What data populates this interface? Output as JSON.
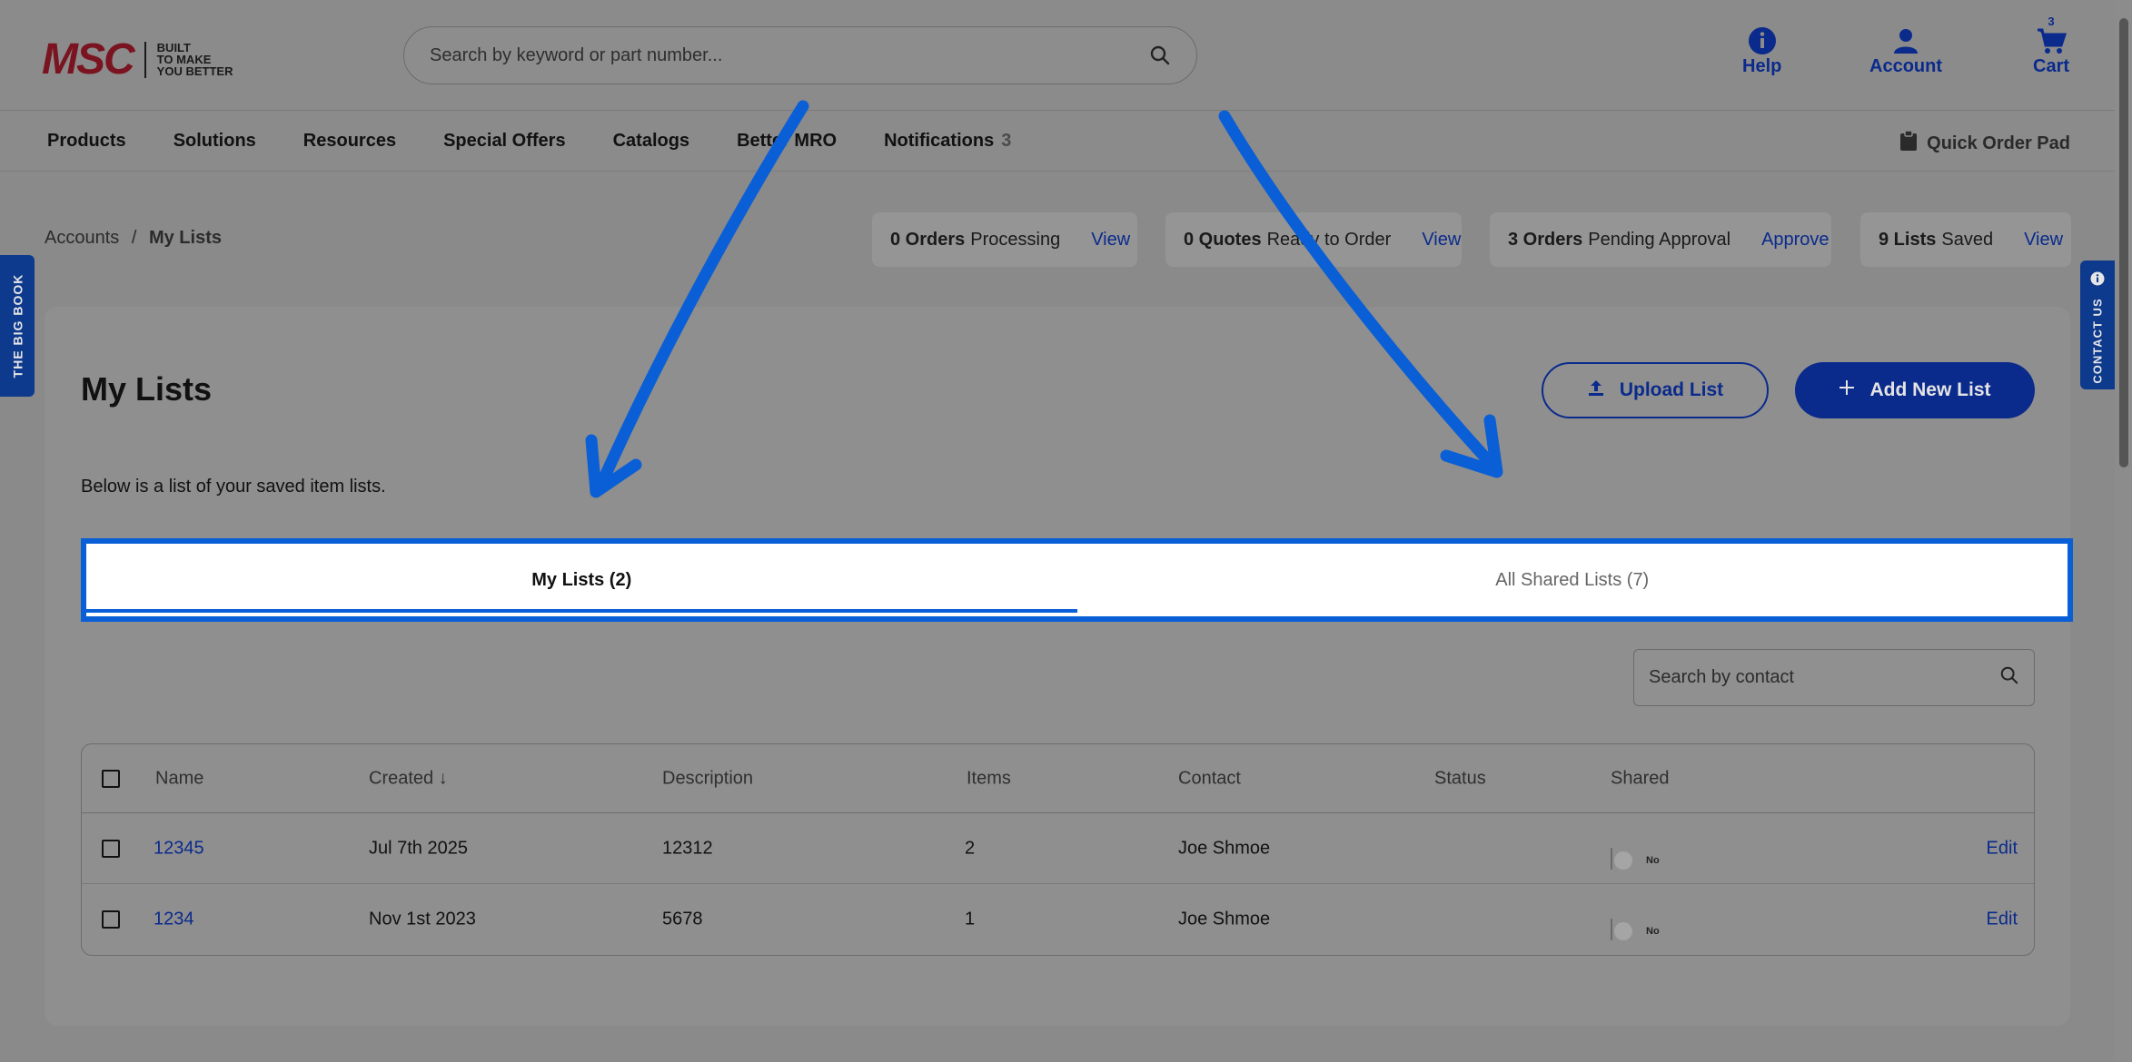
{
  "header": {
    "logo_text": "MSC",
    "logo_tagline": [
      "BUILT",
      "TO MAKE",
      "YOU BETTER"
    ],
    "search_placeholder": "Search by keyword or part number...",
    "help_label": "Help",
    "account_label": "Account",
    "cart_label": "Cart",
    "cart_count": "3"
  },
  "nav": {
    "items": [
      "Products",
      "Solutions",
      "Resources",
      "Special Offers",
      "Catalogs",
      "Better MRO"
    ],
    "notifications_label": "Notifications",
    "notifications_count": "3",
    "quick_order_label": "Quick Order Pad"
  },
  "breadcrumb": {
    "parent": "Accounts",
    "separator": "/",
    "current": "My Lists"
  },
  "status_pills": [
    {
      "count": "0 Orders",
      "text": "Processing",
      "action": "View"
    },
    {
      "count": "0 Quotes",
      "text": "Ready to Order",
      "action": "View"
    },
    {
      "count": "3 Orders",
      "text": "Pending Approval",
      "action": "Approve"
    },
    {
      "count": "9 Lists",
      "text": "Saved",
      "action": "View"
    }
  ],
  "side": {
    "left_label": "THE BIG BOOK",
    "right_label": "CONTACT US"
  },
  "main": {
    "title": "My Lists",
    "upload_label": "Upload List",
    "add_label": "Add New List",
    "description": "Below is a list of your saved item lists.",
    "tabs": [
      {
        "label": "My Lists (2)",
        "active": true
      },
      {
        "label": "All Shared Lists (7)",
        "active": false
      }
    ],
    "contact_search_placeholder": "Search by contact"
  },
  "table": {
    "columns": [
      "Name",
      "Created ↓",
      "Description",
      "Items",
      "Contact",
      "Status",
      "Shared"
    ],
    "rows": [
      {
        "name": "12345",
        "created": "Jul 7th 2025",
        "description": "12312",
        "items": "2",
        "contact": "Joe Shmoe",
        "status": "",
        "shared": "No",
        "action": "Edit"
      },
      {
        "name": "1234",
        "created": "Nov 1st 2023",
        "description": "5678",
        "items": "1",
        "contact": "Joe Shmoe",
        "status": "",
        "shared": "No",
        "action": "Edit"
      }
    ]
  },
  "colors": {
    "brand_blue": "#0a2a8c",
    "highlight_blue": "#0a5fd6",
    "logo_red": "#7a1420"
  }
}
